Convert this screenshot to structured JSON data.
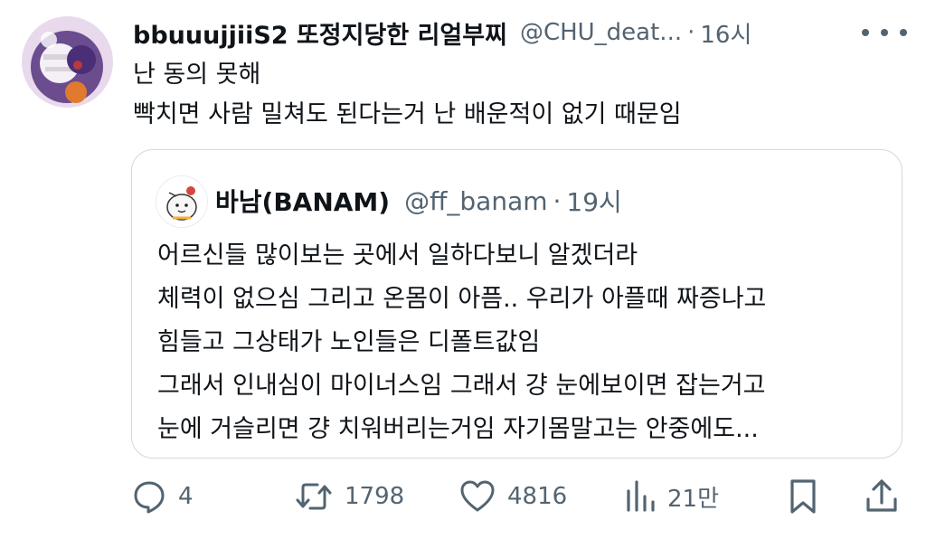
{
  "tweet": {
    "display_name": "bbuuujjiiS2 또정지당한 리얼부찌",
    "handle": "@CHU_deat...",
    "separator": "·",
    "time": "16시",
    "lines": [
      "난 동의 못해",
      "빡치면 사람 밀쳐도 된다는거 난 배운적이 없기 때문임"
    ]
  },
  "quote": {
    "display_name": "바남(BANAM)",
    "handle": "@ff_banam",
    "separator": "·",
    "time": "19시",
    "lines": [
      "어르신들 많이보는 곳에서 일하다보니 알겠더라",
      "체력이 없으심 그리고 온몸이 아픔.. 우리가 아플때 짜증나고",
      "힘들고 그상태가 노인들은 디폴트값임",
      "그래서 인내심이 마이너스임 그래서 걍 눈에보이면 잡는거고",
      "눈에 거슬리면 걍 치워버리는거임 자기몸말고는 안중에도..."
    ]
  },
  "actions": {
    "reply_count": "4",
    "retweet_count": "1798",
    "like_count": "4816",
    "views_count": "21만"
  },
  "icons": {
    "more": "more-horizontal-icon",
    "reply": "reply-icon",
    "retweet": "retweet-icon",
    "like": "heart-icon",
    "views": "views-chart-icon",
    "bookmark": "bookmark-icon",
    "share": "share-icon"
  },
  "colors": {
    "text": "#0f1419",
    "secondary": "#536471",
    "border": "#cfd9de"
  }
}
